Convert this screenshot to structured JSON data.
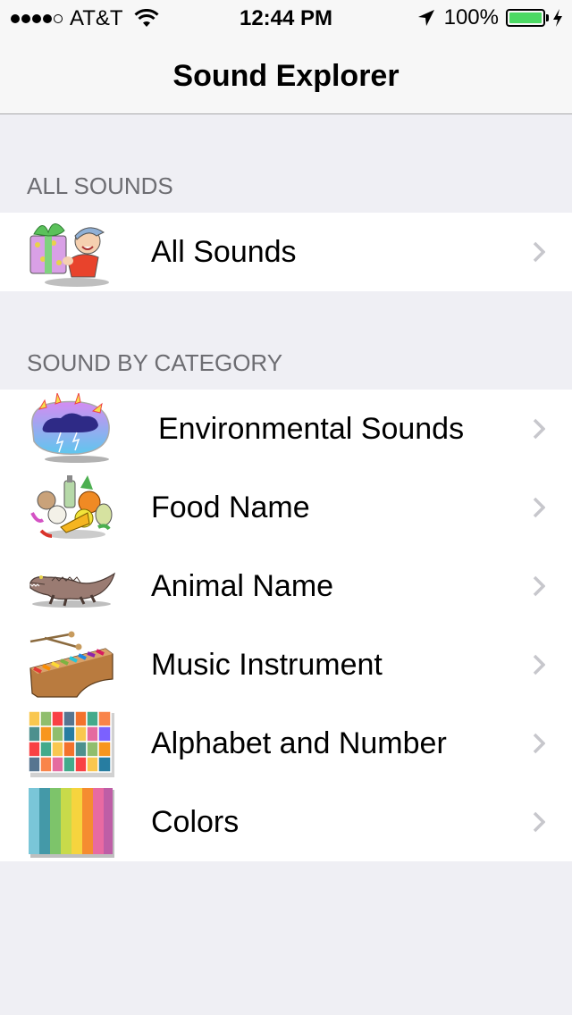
{
  "status_bar": {
    "signal_bars_filled": 4,
    "signal_bars_total": 5,
    "carrier": "AT&T",
    "time": "12:44 PM",
    "battery_percent": "100%",
    "battery_level": 1.0,
    "charging": true,
    "battery_color": "#4CD964",
    "icons": [
      "wifi-icon",
      "location-arrow-icon",
      "battery-icon",
      "charging-bolt-icon"
    ]
  },
  "nav": {
    "title": "Sound Explorer"
  },
  "sections": [
    {
      "header": "ALL SOUNDS",
      "rows": [
        {
          "label": "All Sounds",
          "icon": "gift-boy-icon"
        }
      ]
    },
    {
      "header": "SOUND BY CATEGORY",
      "rows": [
        {
          "label": "Environmental Sounds",
          "icon": "thunderstorm-icon"
        },
        {
          "label": "Food Name",
          "icon": "food-basket-icon"
        },
        {
          "label": "Animal Name",
          "icon": "crocodile-icon"
        },
        {
          "label": "Music Instrument",
          "icon": "xylophone-icon"
        },
        {
          "label": "Alphabet and Number",
          "icon": "alphabet-cards-icon"
        },
        {
          "label": "Colors",
          "icon": "color-stripes-icon"
        }
      ]
    }
  ],
  "colors": {
    "background": "#EFEFF4",
    "bar_background": "#F7F7F7",
    "section_header_text": "#6D6D72",
    "chevron": "#C7C7CC"
  }
}
